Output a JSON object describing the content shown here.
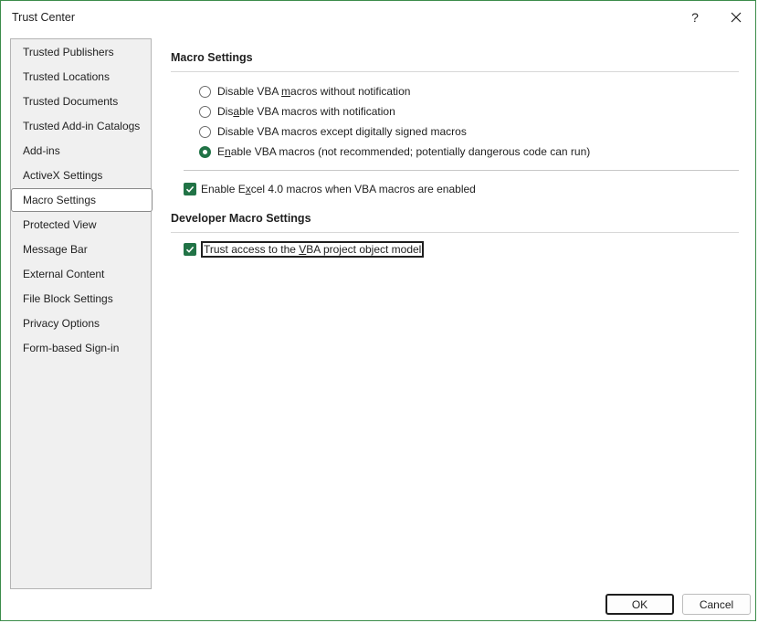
{
  "window": {
    "title": "Trust Center",
    "help_label": "?"
  },
  "sidebar": {
    "items": [
      {
        "label": "Trusted Publishers"
      },
      {
        "label": "Trusted Locations"
      },
      {
        "label": "Trusted Documents"
      },
      {
        "label": "Trusted Add-in Catalogs"
      },
      {
        "label": "Add-ins"
      },
      {
        "label": "ActiveX Settings"
      },
      {
        "label": "Macro Settings",
        "selected": true
      },
      {
        "label": "Protected View"
      },
      {
        "label": "Message Bar"
      },
      {
        "label": "External Content"
      },
      {
        "label": "File Block Settings"
      },
      {
        "label": "Privacy Options"
      },
      {
        "label": "Form-based Sign-in"
      }
    ]
  },
  "macro_settings": {
    "heading": "Macro Settings",
    "options": [
      {
        "pre": "Disable VBA ",
        "ul": "m",
        "post": "acros without notification",
        "checked": false
      },
      {
        "pre": "Dis",
        "ul": "a",
        "post": "ble VBA macros with notification",
        "checked": false
      },
      {
        "pre": "Disable VBA macros except di",
        "ul": "g",
        "post": "itally signed macros",
        "checked": false
      },
      {
        "pre": "E",
        "ul": "n",
        "post": "able VBA macros (not recommended; potentially dangerous code can run)",
        "checked": true
      }
    ],
    "excel4": {
      "pre": "Enable E",
      "ul": "x",
      "post": "cel 4.0 macros when VBA macros are enabled",
      "checked": true
    }
  },
  "developer": {
    "heading": "Developer Macro Settings",
    "trust_vba": {
      "pre": "Trust access to the ",
      "ul": "V",
      "post": "BA project object model",
      "checked": true
    }
  },
  "footer": {
    "ok_label": "OK",
    "cancel_label": "Cancel"
  },
  "colors": {
    "accent": "#217346",
    "window_border": "#3c8c4a"
  }
}
